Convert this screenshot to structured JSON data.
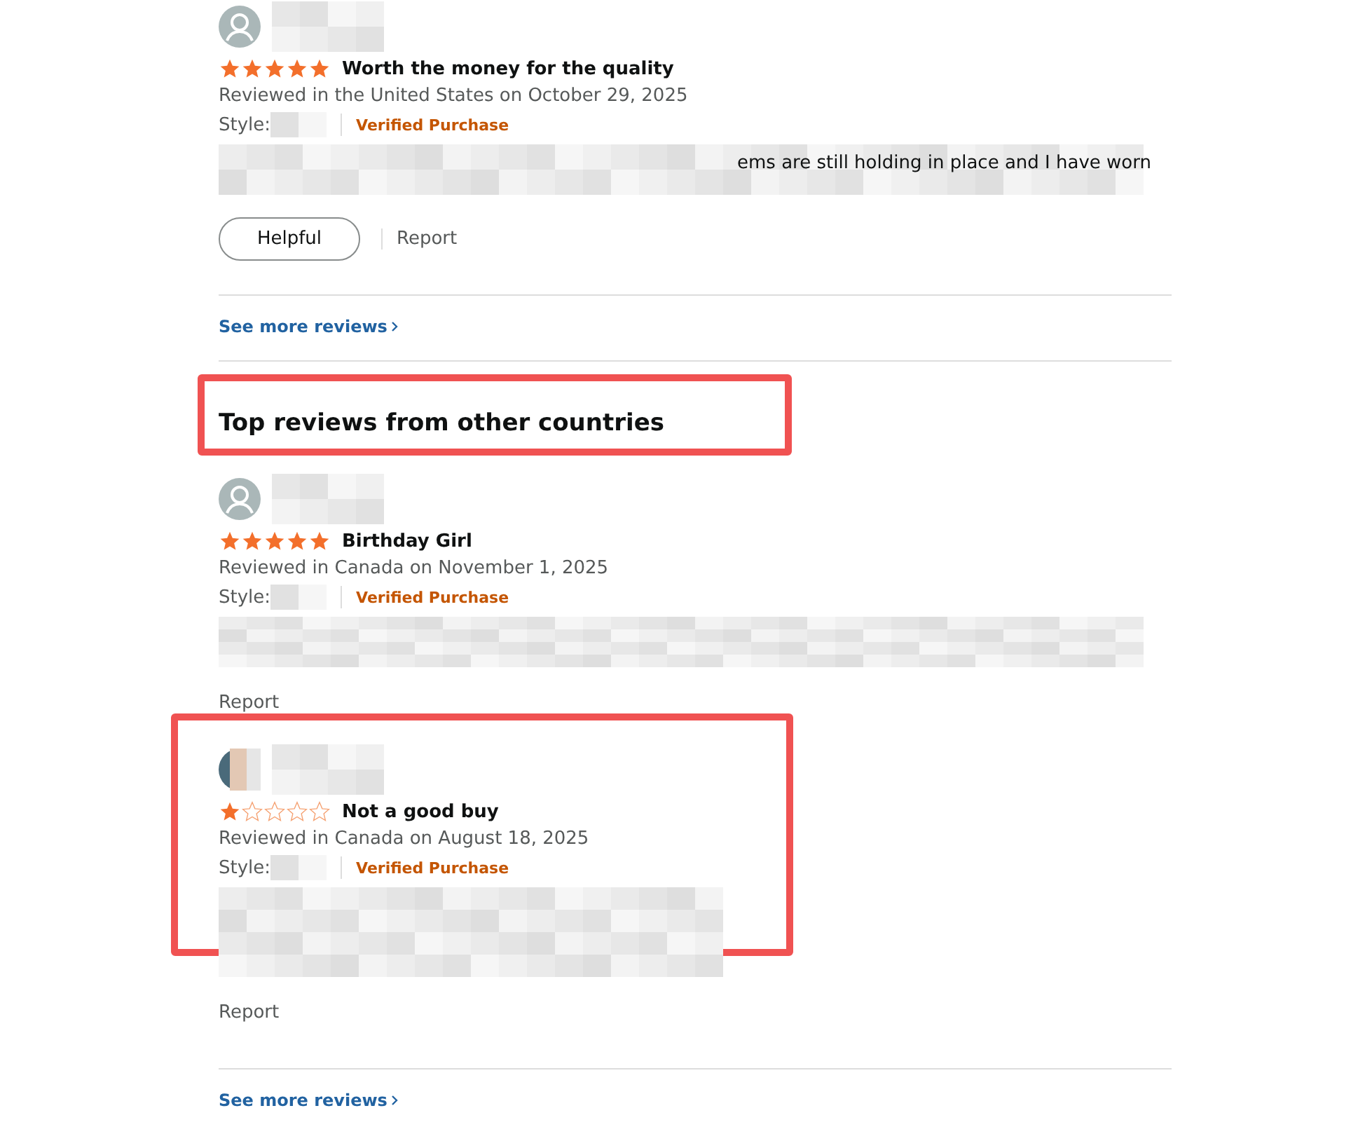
{
  "top_reviews": {
    "reviews": [
      {
        "avatar": {
          "kind": "default"
        },
        "stars": 5,
        "title": "Worth the money for the quality",
        "meta": "Reviewed in the United States on October 29, 2025",
        "style_label": "Style:",
        "verified": "Verified Purchase",
        "body_fragment": "ems are still holding in place and I have worn",
        "helpful_button": "Helpful",
        "report": "Report",
        "highlighted": false
      }
    ],
    "see_more": "See more reviews"
  },
  "other_countries": {
    "heading": "Top reviews from other countries",
    "heading_highlighted": true,
    "reviews": [
      {
        "avatar": {
          "kind": "default"
        },
        "stars": 5,
        "title": "Birthday Girl",
        "meta": "Reviewed in Canada on November 1, 2025",
        "style_label": "Style:",
        "verified": "Verified Purchase",
        "report": "Report",
        "highlighted": false
      },
      {
        "stars": 1,
        "title": "Not a good buy",
        "meta": "Reviewed in Canada on August 18, 2025",
        "style_label": "Style:",
        "verified": "Verified Purchase",
        "report": "Report",
        "highlighted": true
      }
    ],
    "see_more": "See more reviews"
  }
}
